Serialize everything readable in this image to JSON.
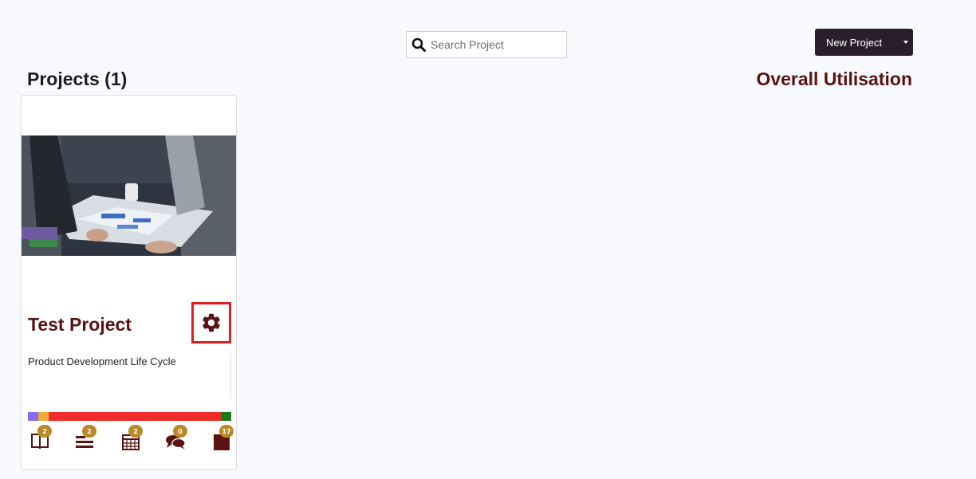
{
  "search": {
    "placeholder": "Search Project",
    "value": ""
  },
  "header": {
    "new_project_label": "New Project"
  },
  "projects": {
    "heading": "Projects (1)"
  },
  "utilisation": {
    "heading": "Overall Utilisation"
  },
  "card": {
    "title": "Test Project",
    "description": "Product Development Life Cycle",
    "progress_segments": [
      {
        "color": "#8b6cf0",
        "fraction": 0.05
      },
      {
        "color": "#f0a93a",
        "fraction": 0.05
      },
      {
        "color": "#f22b2b",
        "fraction": 0.85
      },
      {
        "color": "#167a16",
        "fraction": 0.05
      }
    ],
    "stats": [
      {
        "icon": "book-icon",
        "count": "2"
      },
      {
        "icon": "tasks-icon",
        "count": "2"
      },
      {
        "icon": "calendar-icon",
        "count": "2"
      },
      {
        "icon": "comments-icon",
        "count": "0"
      },
      {
        "icon": "bookmark-icon",
        "count": "17"
      }
    ]
  },
  "colors": {
    "accent": "#5a1212",
    "button_bg": "#2a1d2c",
    "badge": "#b98a2b",
    "highlight_border": "#e02020"
  }
}
